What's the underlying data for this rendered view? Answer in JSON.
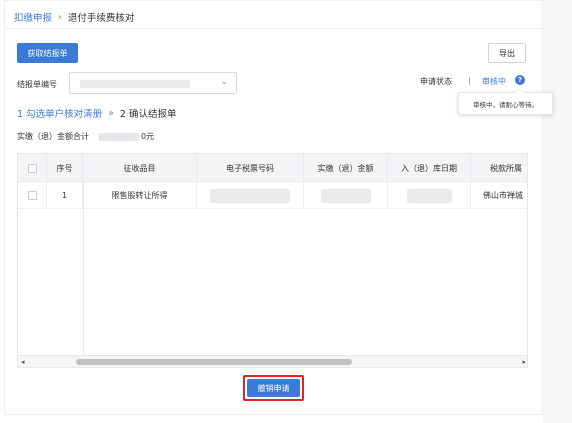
{
  "breadcrumb": {
    "parent": "扣缴申报",
    "separator": "›",
    "current": "退付手续费核对"
  },
  "toolbar": {
    "fetch_button": "获取结报单",
    "export_button": "导出"
  },
  "form": {
    "settlement_no_label": "结报单编号",
    "settlement_no_value": "",
    "chevron": "⌄"
  },
  "status": {
    "label": "申请状态",
    "divider": "|",
    "value": "审核中",
    "tooltip": "审核中，请耐心等待。"
  },
  "steps": {
    "step1": "1 勾选单户核对清册",
    "arrow": "»",
    "step2": "2 确认结报单"
  },
  "summary": {
    "label": "实缴（退）金额合计",
    "suffix": "0元"
  },
  "table": {
    "columns": [
      "",
      "序号",
      "征收品目",
      "电子税票号码",
      "实缴（退）金额",
      "入（退）库日期",
      "税款所属"
    ],
    "rows": [
      {
        "index": "1",
        "item": "限售股转让所得",
        "ticket_no": "",
        "amount": "",
        "date": "",
        "office": "佛山市禅城"
      }
    ]
  },
  "scroll": {
    "left_arrow": "◂",
    "right_arrow": "▸"
  },
  "actions": {
    "cancel_button": "撤销申请"
  },
  "colors": {
    "primary": "#3c7ad9",
    "highlight": "#e3242b"
  }
}
